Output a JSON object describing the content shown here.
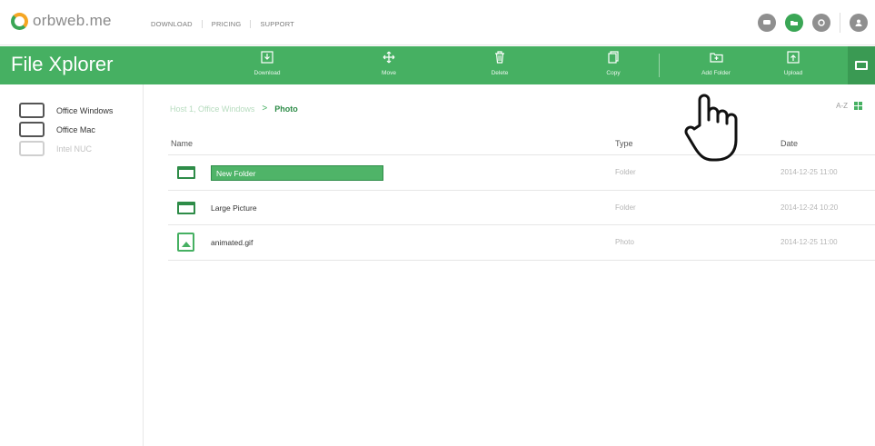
{
  "brand": {
    "name": "orbweb.me",
    "ring_color": "#3aa655",
    "accent": "#f5a623"
  },
  "topnav": [
    "DOWNLOAD",
    "PRICING",
    "SUPPORT"
  ],
  "top_icons": [
    {
      "name": "chat-icon",
      "color": "#8f8f8f"
    },
    {
      "name": "folder-icon",
      "color": "#3aa655"
    },
    {
      "name": "camera-icon",
      "color": "#8f8f8f"
    },
    {
      "name": "user-icon",
      "color": "#8f8f8f"
    }
  ],
  "toolbar": {
    "title": "File Xplorer",
    "color": "#46b062",
    "actions": [
      {
        "label": "Download",
        "icon": "download-icon"
      },
      {
        "label": "Move",
        "icon": "move-icon"
      },
      {
        "label": "Delete",
        "icon": "trash-icon"
      },
      {
        "label": "Copy",
        "icon": "copy-icon"
      },
      {
        "label": "Add Folder",
        "icon": "add-folder-icon"
      },
      {
        "label": "Upload",
        "icon": "upload-icon"
      }
    ]
  },
  "sidebar": {
    "devices": [
      {
        "label": "Office Windows",
        "online": true
      },
      {
        "label": "Office Mac",
        "online": true
      },
      {
        "label": "Intel NUC",
        "online": false
      }
    ]
  },
  "breadcrumb": {
    "parent": "Host 1, Office Windows",
    "separator": ">",
    "current": "Photo"
  },
  "sort": {
    "label": "A-Z"
  },
  "table": {
    "columns": {
      "name": "Name",
      "type": "Type",
      "date": "Date"
    },
    "rows": [
      {
        "icon": "folder-icon",
        "name": "New Folder",
        "type": "Folder",
        "date": "2014-12-25 11:00",
        "editing": true
      },
      {
        "icon": "folder-icon",
        "name": "Large Picture",
        "type": "Folder",
        "date": "2014-12-24 10:20",
        "editing": false
      },
      {
        "icon": "image-file-icon",
        "name": "animated.gif",
        "type": "Photo",
        "date": "2014-12-25 11:00",
        "editing": false
      }
    ]
  }
}
